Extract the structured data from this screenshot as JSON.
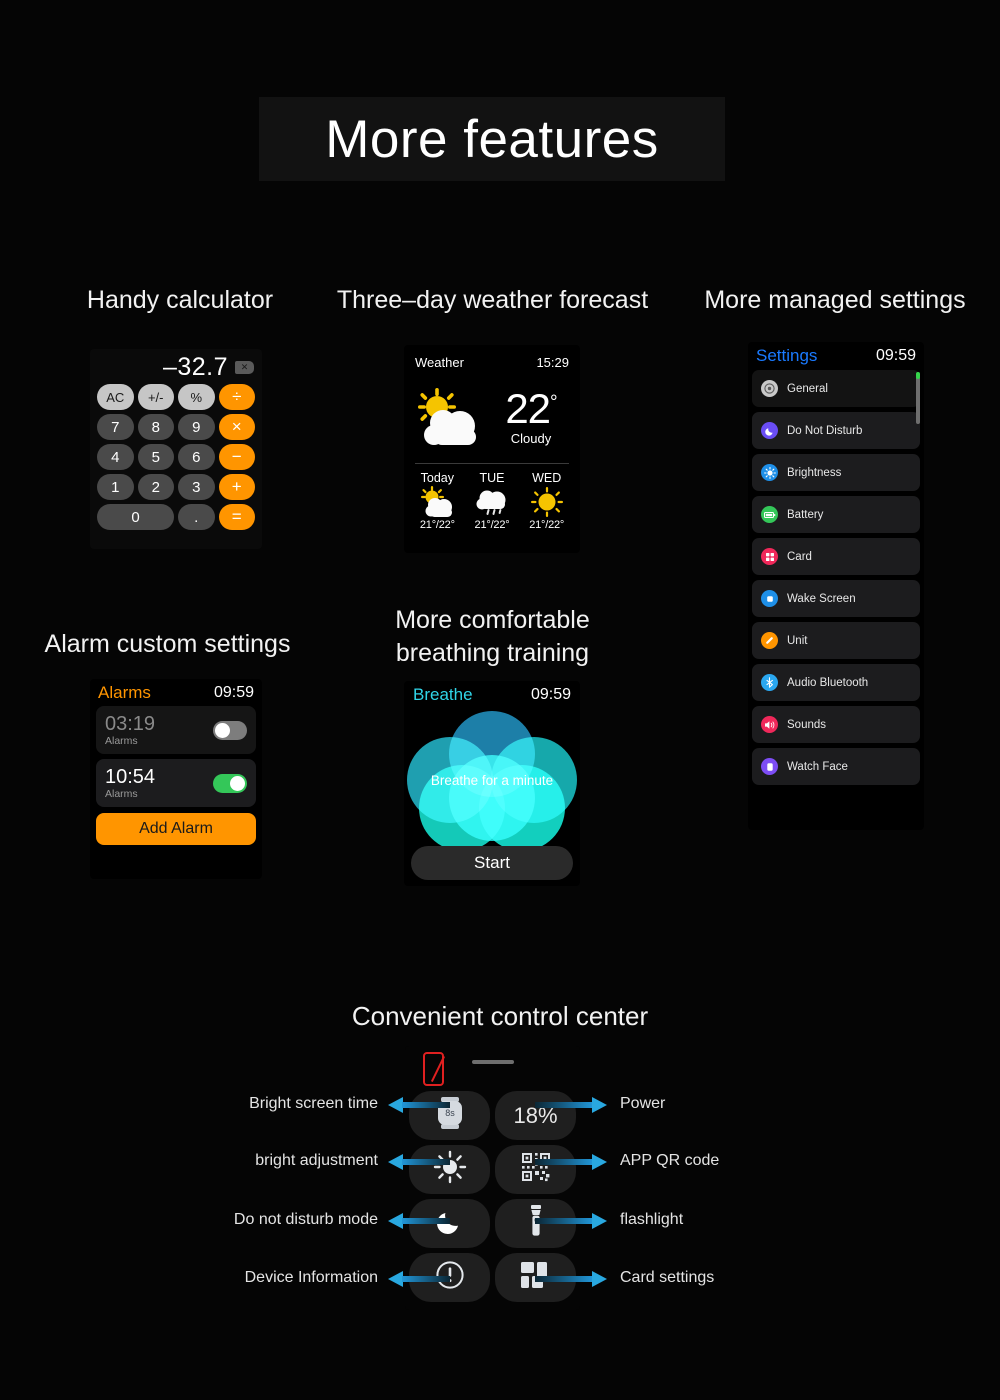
{
  "page": {
    "title": "More features"
  },
  "sections": {
    "calculator": {
      "heading": "Handy calculator"
    },
    "weather": {
      "heading": "Three–day weather forecast"
    },
    "settings": {
      "heading": "More managed settings"
    },
    "alarms": {
      "heading": "Alarm custom settings"
    },
    "breathe": {
      "heading_line1": "More comfortable",
      "heading_line2": "breathing training"
    },
    "control_center": {
      "heading": "Convenient control center"
    }
  },
  "calculator": {
    "display_value": "–32.7",
    "backspace_icon": "backspace-icon",
    "keys": [
      {
        "label": "AC",
        "type": "fn"
      },
      {
        "label": "+/-",
        "type": "fn"
      },
      {
        "label": "%",
        "type": "fn"
      },
      {
        "label": "÷",
        "type": "op"
      },
      {
        "label": "7",
        "type": "num"
      },
      {
        "label": "8",
        "type": "num"
      },
      {
        "label": "9",
        "type": "num"
      },
      {
        "label": "×",
        "type": "op"
      },
      {
        "label": "4",
        "type": "num"
      },
      {
        "label": "5",
        "type": "num"
      },
      {
        "label": "6",
        "type": "num"
      },
      {
        "label": "−",
        "type": "op"
      },
      {
        "label": "1",
        "type": "num"
      },
      {
        "label": "2",
        "type": "num"
      },
      {
        "label": "3",
        "type": "num"
      },
      {
        "label": "+",
        "type": "op"
      },
      {
        "label": "0",
        "type": "zero"
      },
      {
        "label": ".",
        "type": "num"
      },
      {
        "label": "=",
        "type": "op"
      }
    ]
  },
  "weather": {
    "app_name": "Weather",
    "time": "15:29",
    "temperature": "22",
    "degree": "°",
    "condition": "Cloudy",
    "now_icon": "sun-behind-cloud-icon",
    "forecast": [
      {
        "day": "Today",
        "icon": "sun-behind-cloud-icon",
        "temps": "21°/22°"
      },
      {
        "day": "TUE",
        "icon": "rain-cloud-icon",
        "temps": "21°/22°"
      },
      {
        "day": "WED",
        "icon": "sun-icon",
        "temps": "21°/22°"
      }
    ]
  },
  "settings": {
    "title": "Settings",
    "time": "09:59",
    "items": [
      {
        "label": "General",
        "icon": "gear-icon",
        "color": "#c9c9c9"
      },
      {
        "label": "Do Not Disturb",
        "icon": "moon-icon",
        "color": "#6a4df5"
      },
      {
        "label": "Brightness",
        "icon": "sun-icon",
        "color": "#1e8fe8"
      },
      {
        "label": "Battery",
        "icon": "battery-icon",
        "color": "#34c759"
      },
      {
        "label": "Card",
        "icon": "grid-icon",
        "color": "#f0285a"
      },
      {
        "label": "Wake Screen",
        "icon": "square-icon",
        "color": "#1e8fe8"
      },
      {
        "label": "Unit",
        "icon": "ruler-icon",
        "color": "#ff9500"
      },
      {
        "label": "Audio Bluetooth",
        "icon": "bluetooth-icon",
        "color": "#2aa7f0"
      },
      {
        "label": "Sounds",
        "icon": "speaker-icon",
        "color": "#f0285a"
      },
      {
        "label": "Watch Face",
        "icon": "watchface-icon",
        "color": "#7d4df5"
      }
    ]
  },
  "alarms": {
    "title": "Alarms",
    "time": "09:59",
    "rows": [
      {
        "time": "03:19",
        "sub": "Alarms",
        "enabled": false
      },
      {
        "time": "10:54",
        "sub": "Alarms",
        "enabled": true
      }
    ],
    "add_button": "Add Alarm"
  },
  "breathe": {
    "title": "Breathe",
    "time": "09:59",
    "prompt": "Breathe for a minute",
    "start_button": "Start"
  },
  "control_center": {
    "battery_icon": "battery-empty-icon",
    "handle": "drag-handle",
    "tiles": [
      {
        "icon": "watch-screen-time-icon",
        "text": "8s",
        "label": "Bright screen time",
        "side": "left"
      },
      {
        "icon": "battery-percent-icon",
        "text": "18%",
        "label": "Power",
        "side": "right"
      },
      {
        "icon": "brightness-icon",
        "text": "",
        "label": "bright adjustment",
        "side": "left"
      },
      {
        "icon": "qr-code-icon",
        "text": "",
        "label": "APP QR code",
        "side": "right"
      },
      {
        "icon": "moon-icon",
        "text": "",
        "label": "Do not disturb mode",
        "side": "left"
      },
      {
        "icon": "flashlight-icon",
        "text": "",
        "label": "flashlight",
        "side": "right"
      },
      {
        "icon": "info-icon",
        "text": "",
        "label": "Device Information",
        "side": "left"
      },
      {
        "icon": "card-grid-icon",
        "text": "",
        "label": "Card settings",
        "side": "right"
      }
    ]
  },
  "colors": {
    "accent_orange": "#ff9500",
    "accent_blue": "#1a7aff",
    "accent_cyan": "#30d5e8",
    "toggle_green": "#34c759",
    "arrow_blue": "#29a8e0"
  }
}
